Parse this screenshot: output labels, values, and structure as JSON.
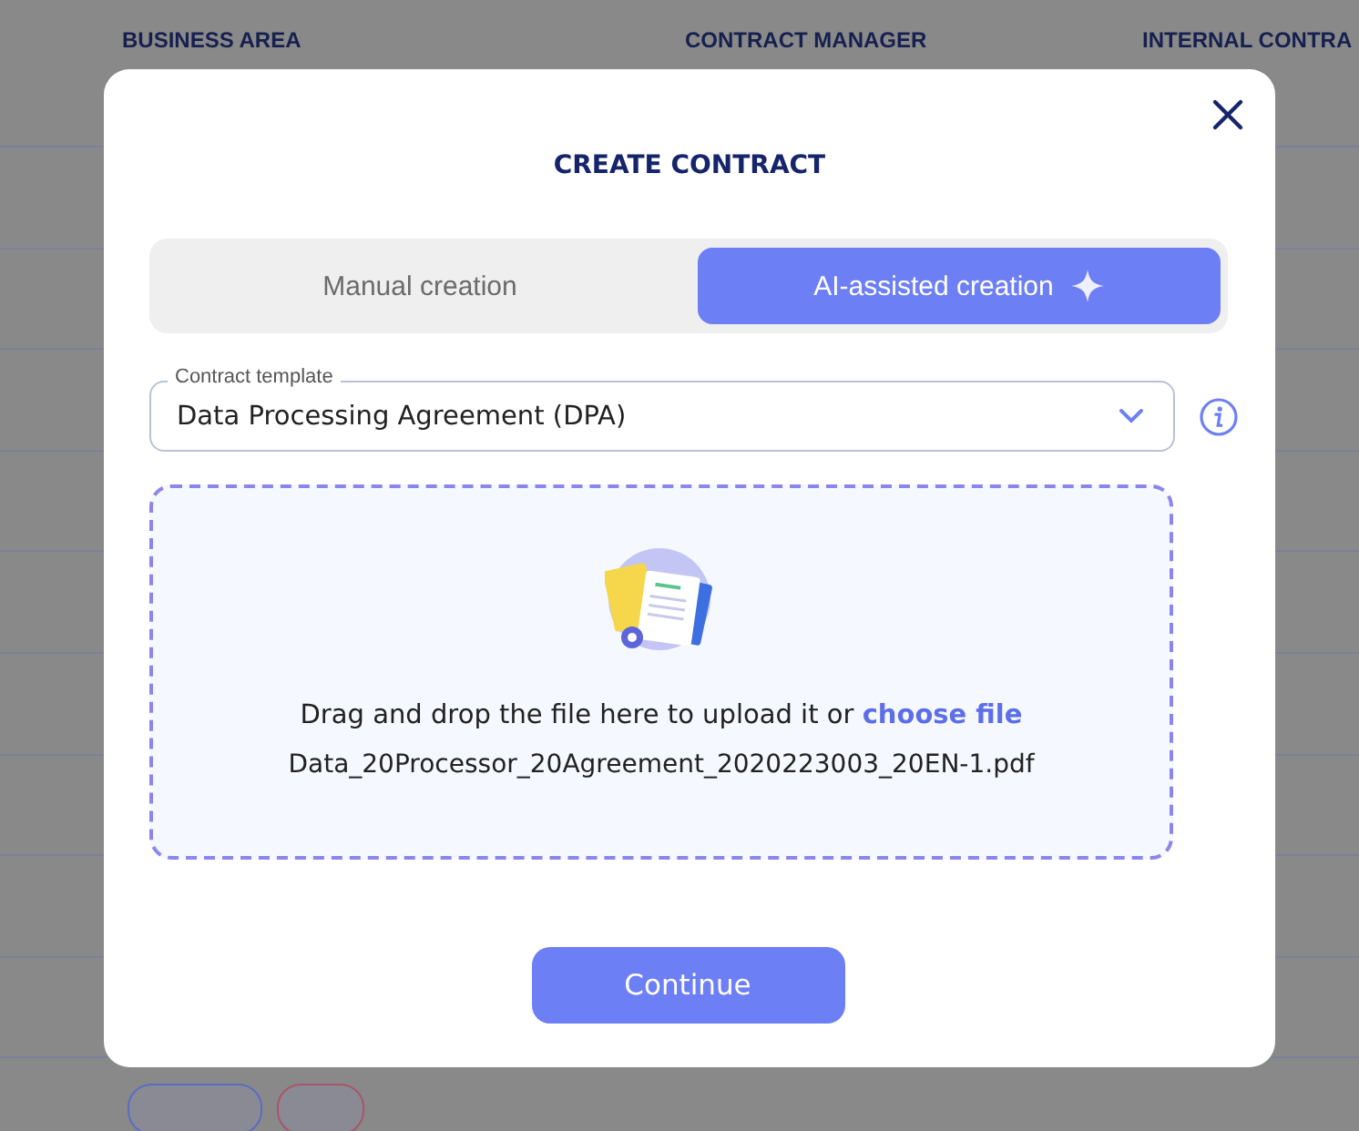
{
  "table": {
    "columns": [
      "BUSINESS AREA",
      "CONTRACT MANAGER",
      "INTERNAL CONTRA"
    ],
    "partial_row": {
      "tags": [
        {
          "color": "#5b6cc4"
        },
        {
          "color": "#a8566a"
        }
      ]
    }
  },
  "dialog": {
    "title": "CREATE CONTRACT",
    "modes": [
      {
        "label": "Manual creation",
        "selected": false,
        "kind": "plain"
      },
      {
        "label": "AI-assisted creation",
        "selected": true,
        "kind": "ai"
      }
    ],
    "template_field": {
      "label": "Contract template",
      "value": "Data Processing Agreement (DPA)"
    },
    "upload": {
      "prompt": "Drag and drop the file here to upload it or",
      "link": "choose file",
      "file_name": "Data_20Processor_20Agreement_2020223003_20EN-1.pdf"
    },
    "buttons": [
      "Continue"
    ]
  }
}
